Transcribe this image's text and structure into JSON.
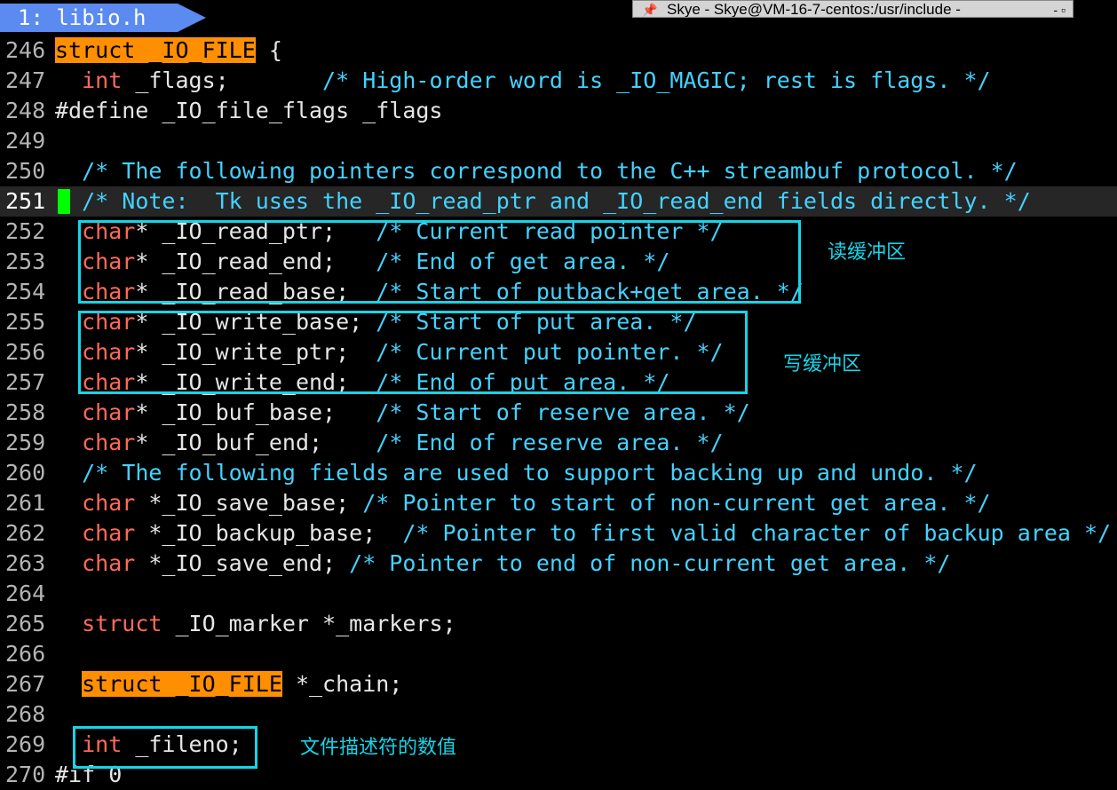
{
  "tab": {
    "label": "1: libio.h"
  },
  "window": {
    "title": "Skye - Skye@VM-16-7-centos:/usr/include -",
    "controls": "- ▫"
  },
  "lines": [
    {
      "num": "246",
      "segs": [
        {
          "t": "",
          "c": ""
        },
        {
          "t": "struct _IO_FILE",
          "c": "hl"
        },
        {
          "t": " {",
          "c": ""
        }
      ]
    },
    {
      "num": "247",
      "segs": [
        {
          "t": "  ",
          "c": ""
        },
        {
          "t": "int",
          "c": "kw"
        },
        {
          "t": " _flags;       ",
          "c": ""
        },
        {
          "t": "/* High-order word is _IO_MAGIC; rest is flags. */",
          "c": "cm"
        }
      ]
    },
    {
      "num": "248",
      "segs": [
        {
          "t": "#define _IO_file_flags _flags",
          "c": ""
        }
      ]
    },
    {
      "num": "249",
      "segs": []
    },
    {
      "num": "250",
      "segs": [
        {
          "t": "  ",
          "c": ""
        },
        {
          "t": "/* The following pointers correspond to the C++ streambuf protocol. */",
          "c": "cm"
        }
      ]
    },
    {
      "num": "251",
      "segs": [
        {
          "t": "  ",
          "c": ""
        },
        {
          "t": "/* Note:  Tk uses the _IO_read_ptr and _IO_read_end fields directly. */",
          "c": "cm"
        }
      ],
      "current": true
    },
    {
      "num": "252",
      "segs": [
        {
          "t": "  ",
          "c": ""
        },
        {
          "t": "char",
          "c": "kw"
        },
        {
          "t": "* _IO_read_ptr;   ",
          "c": ""
        },
        {
          "t": "/* Current read pointer */",
          "c": "cm"
        }
      ]
    },
    {
      "num": "253",
      "segs": [
        {
          "t": "  ",
          "c": ""
        },
        {
          "t": "char",
          "c": "kw"
        },
        {
          "t": "* _IO_read_end;   ",
          "c": ""
        },
        {
          "t": "/* End of get area. */",
          "c": "cm"
        }
      ]
    },
    {
      "num": "254",
      "segs": [
        {
          "t": "  ",
          "c": ""
        },
        {
          "t": "char",
          "c": "kw"
        },
        {
          "t": "* _IO_read_base;  ",
          "c": ""
        },
        {
          "t": "/* Start of putback+get area. */",
          "c": "cm"
        }
      ]
    },
    {
      "num": "255",
      "segs": [
        {
          "t": "  ",
          "c": ""
        },
        {
          "t": "char",
          "c": "kw"
        },
        {
          "t": "* _IO_write_base; ",
          "c": ""
        },
        {
          "t": "/* Start of put area. */",
          "c": "cm"
        }
      ]
    },
    {
      "num": "256",
      "segs": [
        {
          "t": "  ",
          "c": ""
        },
        {
          "t": "char",
          "c": "kw"
        },
        {
          "t": "* _IO_write_ptr;  ",
          "c": ""
        },
        {
          "t": "/* Current put pointer. */",
          "c": "cm"
        }
      ]
    },
    {
      "num": "257",
      "segs": [
        {
          "t": "  ",
          "c": ""
        },
        {
          "t": "char",
          "c": "kw"
        },
        {
          "t": "* _IO_write_end;  ",
          "c": ""
        },
        {
          "t": "/* End of put area. */",
          "c": "cm"
        }
      ]
    },
    {
      "num": "258",
      "segs": [
        {
          "t": "  ",
          "c": ""
        },
        {
          "t": "char",
          "c": "kw"
        },
        {
          "t": "* _IO_buf_base;   ",
          "c": ""
        },
        {
          "t": "/* Start of reserve area. */",
          "c": "cm"
        }
      ]
    },
    {
      "num": "259",
      "segs": [
        {
          "t": "  ",
          "c": ""
        },
        {
          "t": "char",
          "c": "kw"
        },
        {
          "t": "* _IO_buf_end;    ",
          "c": ""
        },
        {
          "t": "/* End of reserve area. */",
          "c": "cm"
        }
      ]
    },
    {
      "num": "260",
      "segs": [
        {
          "t": "  ",
          "c": ""
        },
        {
          "t": "/* The following fields are used to support backing up and undo. */",
          "c": "cm"
        }
      ]
    },
    {
      "num": "261",
      "segs": [
        {
          "t": "  ",
          "c": ""
        },
        {
          "t": "char",
          "c": "kw"
        },
        {
          "t": " *_IO_save_base; ",
          "c": ""
        },
        {
          "t": "/* Pointer to start of non-current get area. */",
          "c": "cm"
        }
      ]
    },
    {
      "num": "262",
      "segs": [
        {
          "t": "  ",
          "c": ""
        },
        {
          "t": "char",
          "c": "kw"
        },
        {
          "t": " *_IO_backup_base;  ",
          "c": ""
        },
        {
          "t": "/* Pointer to first valid character of backup area */",
          "c": "cm"
        }
      ]
    },
    {
      "num": "263",
      "segs": [
        {
          "t": "  ",
          "c": ""
        },
        {
          "t": "char",
          "c": "kw"
        },
        {
          "t": " *_IO_save_end; ",
          "c": ""
        },
        {
          "t": "/* Pointer to end of non-current get area. */",
          "c": "cm"
        }
      ]
    },
    {
      "num": "264",
      "segs": []
    },
    {
      "num": "265",
      "segs": [
        {
          "t": "  ",
          "c": ""
        },
        {
          "t": "struct",
          "c": "kw"
        },
        {
          "t": " _IO_marker *_markers;",
          "c": ""
        }
      ]
    },
    {
      "num": "266",
      "segs": []
    },
    {
      "num": "267",
      "segs": [
        {
          "t": "  ",
          "c": ""
        },
        {
          "t": "struct _IO_FILE",
          "c": "hl"
        },
        {
          "t": " *_chain;",
          "c": ""
        }
      ]
    },
    {
      "num": "268",
      "segs": []
    },
    {
      "num": "269",
      "segs": [
        {
          "t": "  ",
          "c": ""
        },
        {
          "t": "int",
          "c": "kw"
        },
        {
          "t": " _fileno;",
          "c": ""
        }
      ]
    },
    {
      "num": "270",
      "segs": [
        {
          "t": "#if 0",
          "c": ""
        }
      ]
    }
  ],
  "annotations": {
    "read_buffer": "读缓冲区",
    "write_buffer": "写缓冲区",
    "fileno_note": "文件描述符的数值"
  },
  "colors": {
    "keyword": "#ff6a58",
    "comment": "#44d2ff",
    "highlight": "#ff8f00",
    "cursor": "#00ff00",
    "tab": "#5b8bf0",
    "annotation": "#17d4e6"
  }
}
